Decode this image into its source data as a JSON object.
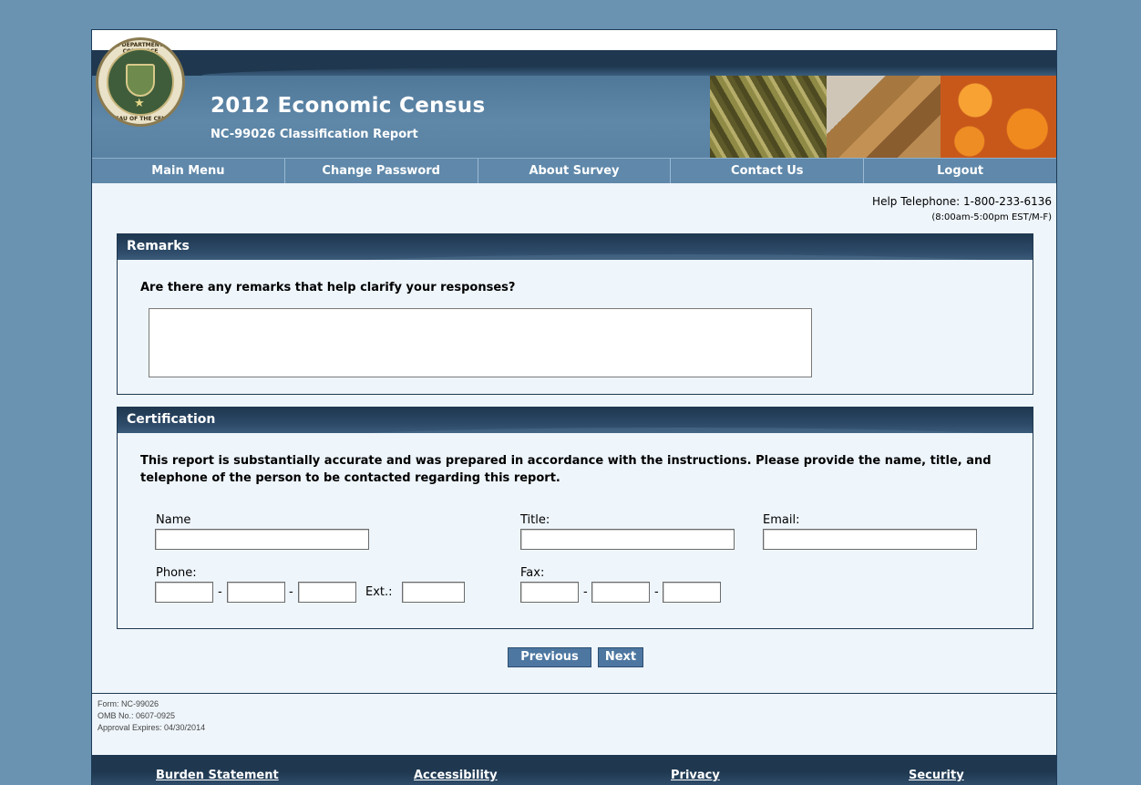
{
  "header": {
    "seal_top_text": "U.S. DEPARTMENT OF COMMERCE",
    "seal_bottom_text": "BUREAU OF THE CENSUS",
    "title": "2012 Economic Census",
    "subtitle": "NC-99026 Classification Report"
  },
  "nav": [
    "Main Menu",
    "Change Password",
    "About Survey",
    "Contact Us",
    "Logout"
  ],
  "help": {
    "phone": "Help Telephone: 1-800-233-6136",
    "hours": "(8:00am-5:00pm EST/M-F)"
  },
  "remarks": {
    "heading": "Remarks",
    "question": "Are there any remarks that help clarify your responses?",
    "value": ""
  },
  "certification": {
    "heading": "Certification",
    "text": "This report is substantially accurate and was prepared in accordance with the instructions. Please provide the name, title, and telephone of the person to be contacted regarding this report.",
    "name_label": "Name",
    "title_label": "Title:",
    "email_label": "Email:",
    "phone_label": "Phone:",
    "ext_label": "Ext.:",
    "fax_label": "Fax:",
    "dash": "-"
  },
  "buttons": {
    "previous": "Previous",
    "next": "Next"
  },
  "form_info": {
    "form": "Form: NC-99026",
    "omb": "OMB No.: 0607-0925",
    "expires": "Approval Expires: 04/30/2014"
  },
  "footer": [
    "Burden Statement",
    "Accessibility",
    "Privacy",
    "Security"
  ],
  "colors": {
    "background": "#6a93b2",
    "header_dark": "#1f3850",
    "nav_blue": "#5f88aa",
    "button_blue": "#4d77a0"
  }
}
